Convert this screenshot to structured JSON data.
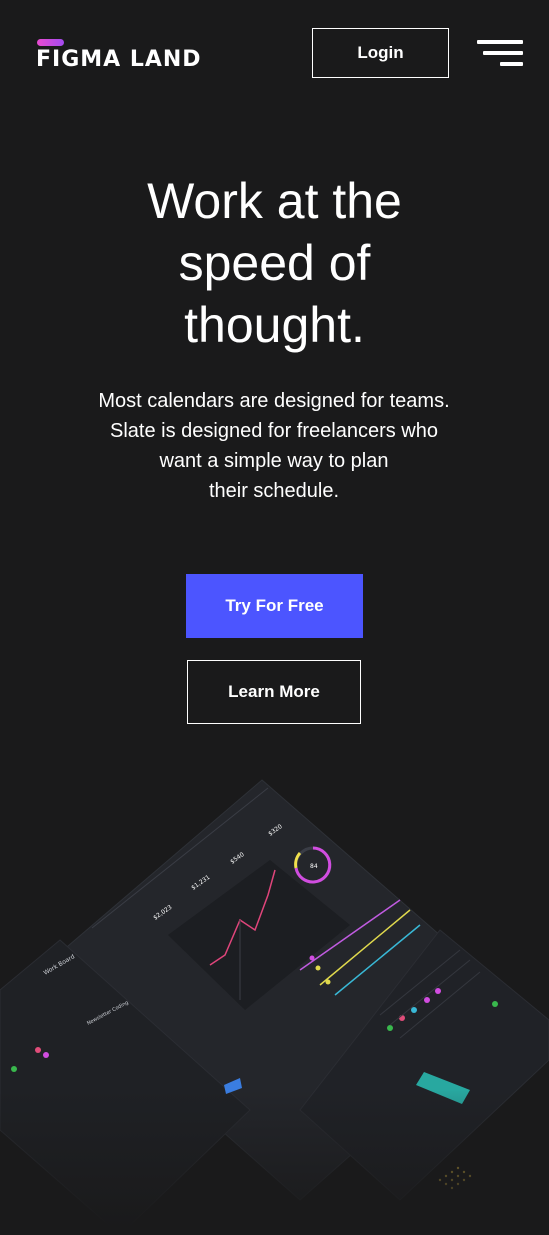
{
  "header": {
    "logo_text": "FIGMA LAND",
    "login_label": "Login"
  },
  "hero": {
    "title_line1": "Work at the",
    "title_line2": "speed of",
    "title_line3": "thought.",
    "subtitle_line1": "Most calendars are designed for teams.",
    "subtitle_line2": "Slate is designed for freelancers who",
    "subtitle_line3": "want a simple way to plan",
    "subtitle_line4": "their schedule.",
    "primary_cta": "Try For Free",
    "secondary_cta": "Learn More"
  },
  "mockup": {
    "board_title": "Work Board",
    "card_title": "Newsletter Coding",
    "stat_1": "$2,023",
    "stat_2": "$1,231",
    "stat_3": "$540",
    "stat_4": "$320",
    "ring_value": "84"
  },
  "colors": {
    "background": "#1a1a1b",
    "primary": "#4c55ff",
    "logo_gradient_start": "#e94bd0",
    "logo_accent": "#38a9ff"
  }
}
